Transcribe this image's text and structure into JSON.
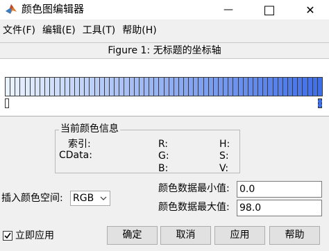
{
  "window": {
    "title": "颜色图编辑器",
    "minimize_glyph": "—",
    "maximize_glyph": "□",
    "close_glyph": "✕"
  },
  "menu": [
    {
      "label": "文件(F)"
    },
    {
      "label": "编辑(E)"
    },
    {
      "label": "工具(T)"
    },
    {
      "label": "帮助(H)"
    }
  ],
  "figure_title": "Figure 1: 无标题的坐标轴",
  "colormap": {
    "start_color": "#eaf2fd",
    "end_color": "#3f6fe8",
    "cell_count": 64,
    "markers": [
      "start",
      "end"
    ]
  },
  "current_color": {
    "legend": "当前颜色信息",
    "index_label": "索引:",
    "cdata_label": "CData:",
    "r_label": "R:",
    "g_label": "G:",
    "b_label": "B:",
    "h_label": "H:",
    "s_label": "S:",
    "v_label": "V:"
  },
  "interp_space": {
    "label": "插入颜色空间:",
    "value": "RGB"
  },
  "cdata_min": {
    "label": "颜色数据最小值:",
    "value": "0.0"
  },
  "cdata_max": {
    "label": "颜色数据最大值:",
    "value": "98.0"
  },
  "apply_immediately": {
    "label": "立即应用",
    "checked": true
  },
  "buttons": {
    "ok": "确定",
    "cancel": "取消",
    "apply": "应用",
    "help": "帮助"
  }
}
